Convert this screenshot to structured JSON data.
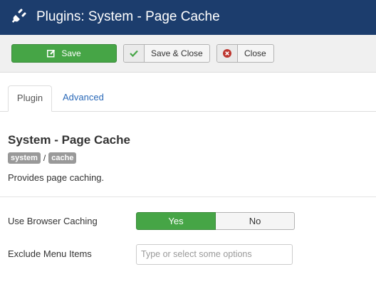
{
  "header": {
    "title": "Plugins: System - Page Cache",
    "icon": "plug-icon"
  },
  "toolbar": {
    "save_label": "Save",
    "save_close_label": "Save & Close",
    "close_label": "Close"
  },
  "tabs": [
    {
      "label": "Plugin",
      "active": true
    },
    {
      "label": "Advanced",
      "active": false
    }
  ],
  "plugin": {
    "title": "System - Page Cache",
    "tags": [
      "system",
      "cache"
    ],
    "tag_separator": "/",
    "description": "Provides page caching."
  },
  "fields": {
    "browser_caching": {
      "label": "Use Browser Caching",
      "options": [
        "Yes",
        "No"
      ],
      "selected": "Yes"
    },
    "exclude_menu_items": {
      "label": "Exclude Menu Items",
      "placeholder": "Type or select some options"
    }
  },
  "colors": {
    "header_bg": "#1c3d6d",
    "success": "#46a546",
    "danger": "#bd362f",
    "link": "#2a69b8"
  }
}
